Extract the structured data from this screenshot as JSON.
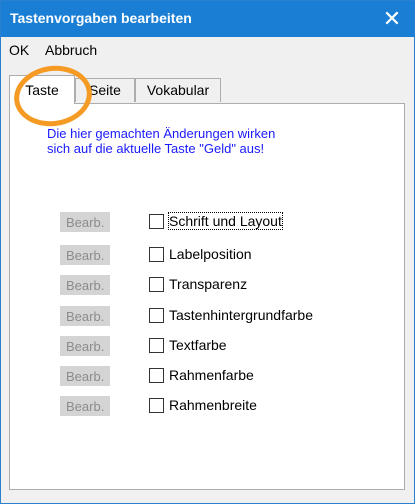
{
  "window": {
    "title": "Tastenvorgaben bearbeiten",
    "close_glyph": "✕"
  },
  "menu": {
    "ok": "OK",
    "cancel": "Abbruch"
  },
  "tabs": [
    {
      "label": "Taste",
      "active": true
    },
    {
      "label": "Seite",
      "active": false
    },
    {
      "label": "Vokabular",
      "active": false
    }
  ],
  "info_text": {
    "line1": "Die hier gemachten Änderungen wirken",
    "line2": "sich auf die aktuelle Taste \"Geld\" aus!"
  },
  "edit_label": "Bearb.",
  "options": [
    {
      "label": "Schrift und Layout",
      "checked": false
    },
    {
      "label": "Labelposition",
      "checked": false
    },
    {
      "label": "Transparenz",
      "checked": false
    },
    {
      "label": "Tastenhintergrundfarbe",
      "checked": false
    },
    {
      "label": "Textfarbe",
      "checked": false
    },
    {
      "label": "Rahmenfarbe",
      "checked": false
    },
    {
      "label": "Rahmenbreite",
      "checked": false
    }
  ],
  "colors": {
    "titlebar": "#1a7fd4",
    "info_text": "#1a1aff",
    "highlight": "#f59a23"
  }
}
